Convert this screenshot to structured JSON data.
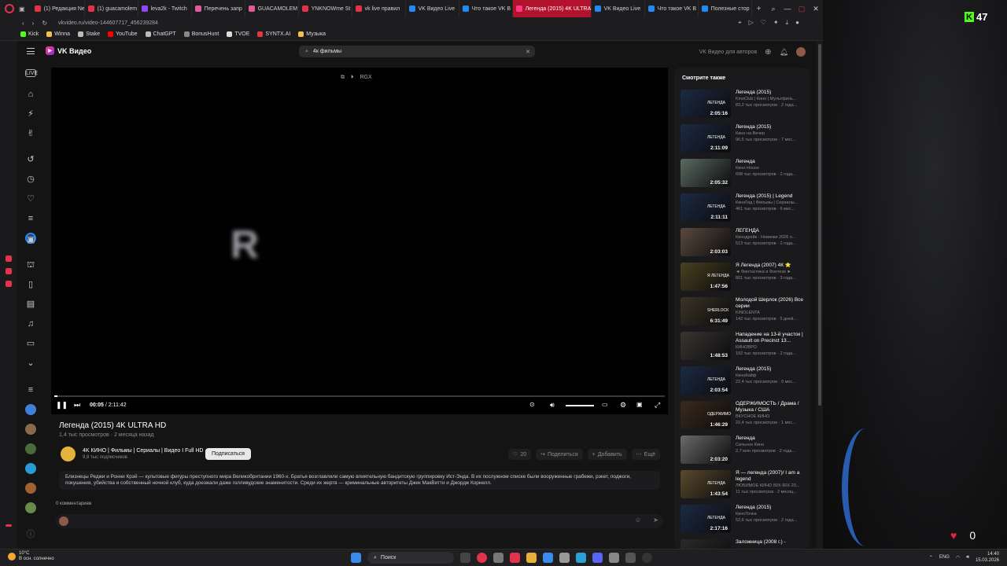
{
  "browser": {
    "tabs": [
      {
        "label": "(1) Редакция Ne",
        "color": "#e2334a"
      },
      {
        "label": "(1) guacamolem",
        "color": "#e2334a"
      },
      {
        "label": "leva2k - Twitch",
        "color": "#9146ff"
      },
      {
        "label": "Перечень запр",
        "color": "#e05a9a"
      },
      {
        "label": "GUACAMOLEM",
        "color": "#e05a9a"
      },
      {
        "label": "YNKNOWme St",
        "color": "#e2334a"
      },
      {
        "label": "vk live правил",
        "color": "#e2334a"
      },
      {
        "label": "VK Видео Live",
        "color": "#2787f5"
      },
      {
        "label": "Что такое VK В",
        "color": "#2787f5"
      },
      {
        "label": "Легенда (2015) 4K ULTRA",
        "color": "#ff3985",
        "active": true
      },
      {
        "label": "VK Видео Live",
        "color": "#2787f5"
      },
      {
        "label": "Что такое VK В",
        "color": "#2787f5"
      },
      {
        "label": "Полезные стор",
        "color": "#2787f5"
      }
    ],
    "url": "vkvideo.ru/video-144607717_456239284",
    "bookmarks": [
      {
        "label": "Kick",
        "color": "#53fc18"
      },
      {
        "label": "Winna",
        "color": "#f2c14b"
      },
      {
        "label": "Stake",
        "color": "#bbbbbb"
      },
      {
        "label": "YouTube",
        "color": "#ff0000"
      },
      {
        "label": "ChatGPT",
        "color": "#bbbbbb"
      },
      {
        "label": "BonusHunt",
        "color": "#888888"
      },
      {
        "label": "TVOE",
        "color": "#dddddd"
      },
      {
        "label": "SYNTX.AI",
        "color": "#e33b3b"
      },
      {
        "label": "Музыка",
        "color": "#f2c14b"
      }
    ]
  },
  "header": {
    "logo": "VK Видео",
    "search_value": "4к фильмы",
    "authors_link": "VK Видео для авторов"
  },
  "player": {
    "overlay_letter": "R",
    "top_label": "RGX",
    "current_time": "00:05",
    "duration": "/ 2:11:42",
    "progress": 0.004
  },
  "video": {
    "title": "Легенда (2015) 4K ULTRA HD",
    "views": "1,4 тыс просмотров",
    "age": "2 месяца назад",
    "channel": "4K КИНО | Фильмы | Сериалы | Видео I Full HD",
    "subscribers": "9,8 тыс подписчиков",
    "subscribe": "Подписаться",
    "likes": "20",
    "share": "Поделиться",
    "add": "Добавить",
    "more": "Ещё",
    "description": "Близнецы Реджи и Ронни Крэй — культовые фигуры преступного мира Великобритании 1960-х. Братья возглавляли самую влиятельную бандитскую группировку Ист-Энда. В их послужном списке были вооруженные грабежи, рэкет, поджоги, покушения, убийства и собственный ночной клуб, куда доезжали даже голливудские знаменитости. Среди их жертв — криминальные авторитеты Джек МакВитти и Джордж Корнелл.",
    "comments_count": "0 комментариев"
  },
  "sidebar": {
    "heading": "Смотрите также",
    "items": [
      {
        "title": "Легенда (2015)",
        "channel": "KinoClub | Кино | Мультфиль...",
        "meta": "83,2 тыс просмотров · 2 года...",
        "duration": "2:05:16",
        "bg": "#1c2a44",
        "overlay": "ЛЕГЕНДА"
      },
      {
        "title": "Легенда (2015)",
        "channel": "Кино на Вечер",
        "meta": "96,5 тыс просмотров · 7 мес...",
        "duration": "2:11:09",
        "bg": "#1c2a44",
        "overlay": "ЛЕГЕНДА"
      },
      {
        "title": "Легенда",
        "channel": "Кино House",
        "meta": "698 тыс просмотров · 2 года...",
        "duration": "2:05:32",
        "bg": "#5b6a62",
        "overlay": ""
      },
      {
        "title": "Легенда (2015) | Legend",
        "channel": "КиноГид | Фильмы | Сериалы...",
        "meta": "461 тыс просмотров · 6 мес...",
        "duration": "2:11:11",
        "bg": "#1c2a44",
        "overlay": "ЛЕГЕНДА"
      },
      {
        "title": "ЛЕГЕНДА",
        "channel": "Кинодрейк · Новинки 2026 о...",
        "meta": "513 тыс просмотров · 2 года...",
        "duration": "2:03:03",
        "bg": "#5a4a3e",
        "overlay": ""
      },
      {
        "title": "Я Легенда (2007) 4К ⭐",
        "channel": "◄ Фантастика и Фэнтези ►",
        "meta": "801 тыс просмотров · 3 года...",
        "duration": "1:47:56",
        "bg": "#4a4120",
        "overlay": "Я ЛЕГЕНДА"
      },
      {
        "title": "Молодой Шерлок (2026) Все серии",
        "channel": "KINOLENTA",
        "meta": "142 тыс просмотров · 5 дней...",
        "duration": "6:31:49",
        "bg": "#3b3426",
        "overlay": "SHERLOCK"
      },
      {
        "title": "Нападение на 13-й участок | Assault on Precinct 13...",
        "channel": "КИНОВРО",
        "meta": "192 тыс просмотров · 2 года...",
        "duration": "1:48:53",
        "bg": "#3a3531",
        "overlay": ""
      },
      {
        "title": "Легенда (2015)",
        "channel": "КиноКайф",
        "meta": "22,4 тыс просмотров · 9 мес...",
        "duration": "2:03:54",
        "bg": "#1c2a44",
        "overlay": "ЛЕГЕНДА"
      },
      {
        "title": "ОДЕРЖИМОСТЬ / Драма / Музыка / США",
        "channel": "ВКУСНОЕ КИНО",
        "meta": "22,4 тыс просмотров · 1 мес...",
        "duration": "1:46:29",
        "bg": "#3a2a1c",
        "overlay": "ОДЕРЖИМОСТЬ"
      },
      {
        "title": "Легенда",
        "channel": "Сильное Кино",
        "meta": "2,7 млн просмотров · 2 года...",
        "duration": "2:03:20",
        "bg": "#6a6a6a",
        "overlay": ""
      },
      {
        "title": "Я — легенда (2007)/ I am a legend",
        "channel": "ЛЮБИМОЕ КИНО 80Х-90Х 20...",
        "meta": "11 тыс просмотров · 2 месяц...",
        "duration": "1:43:54",
        "bg": "#5b4a2c",
        "overlay": "ЛЕГЕНДА"
      },
      {
        "title": "Легенда (2015)",
        "channel": "КиноТочка",
        "meta": "52,6 тыс просмотров · 2 года...",
        "duration": "2:17:16",
        "bg": "#1c2a44",
        "overlay": "ЛЕГЕНДА"
      },
      {
        "title": "Заложница (2008 г.) -",
        "channel": "",
        "meta": "",
        "duration": "",
        "bg": "#2a2a2a",
        "overlay": ""
      }
    ]
  },
  "overlay": {
    "kick_count": "47",
    "hearts_count": "0"
  },
  "taskbar": {
    "temp": "10°C",
    "weather": "В осн. солнечно",
    "search": "Поиск",
    "lang": "ENG",
    "time": "14:40",
    "date": "15.03.2026"
  }
}
